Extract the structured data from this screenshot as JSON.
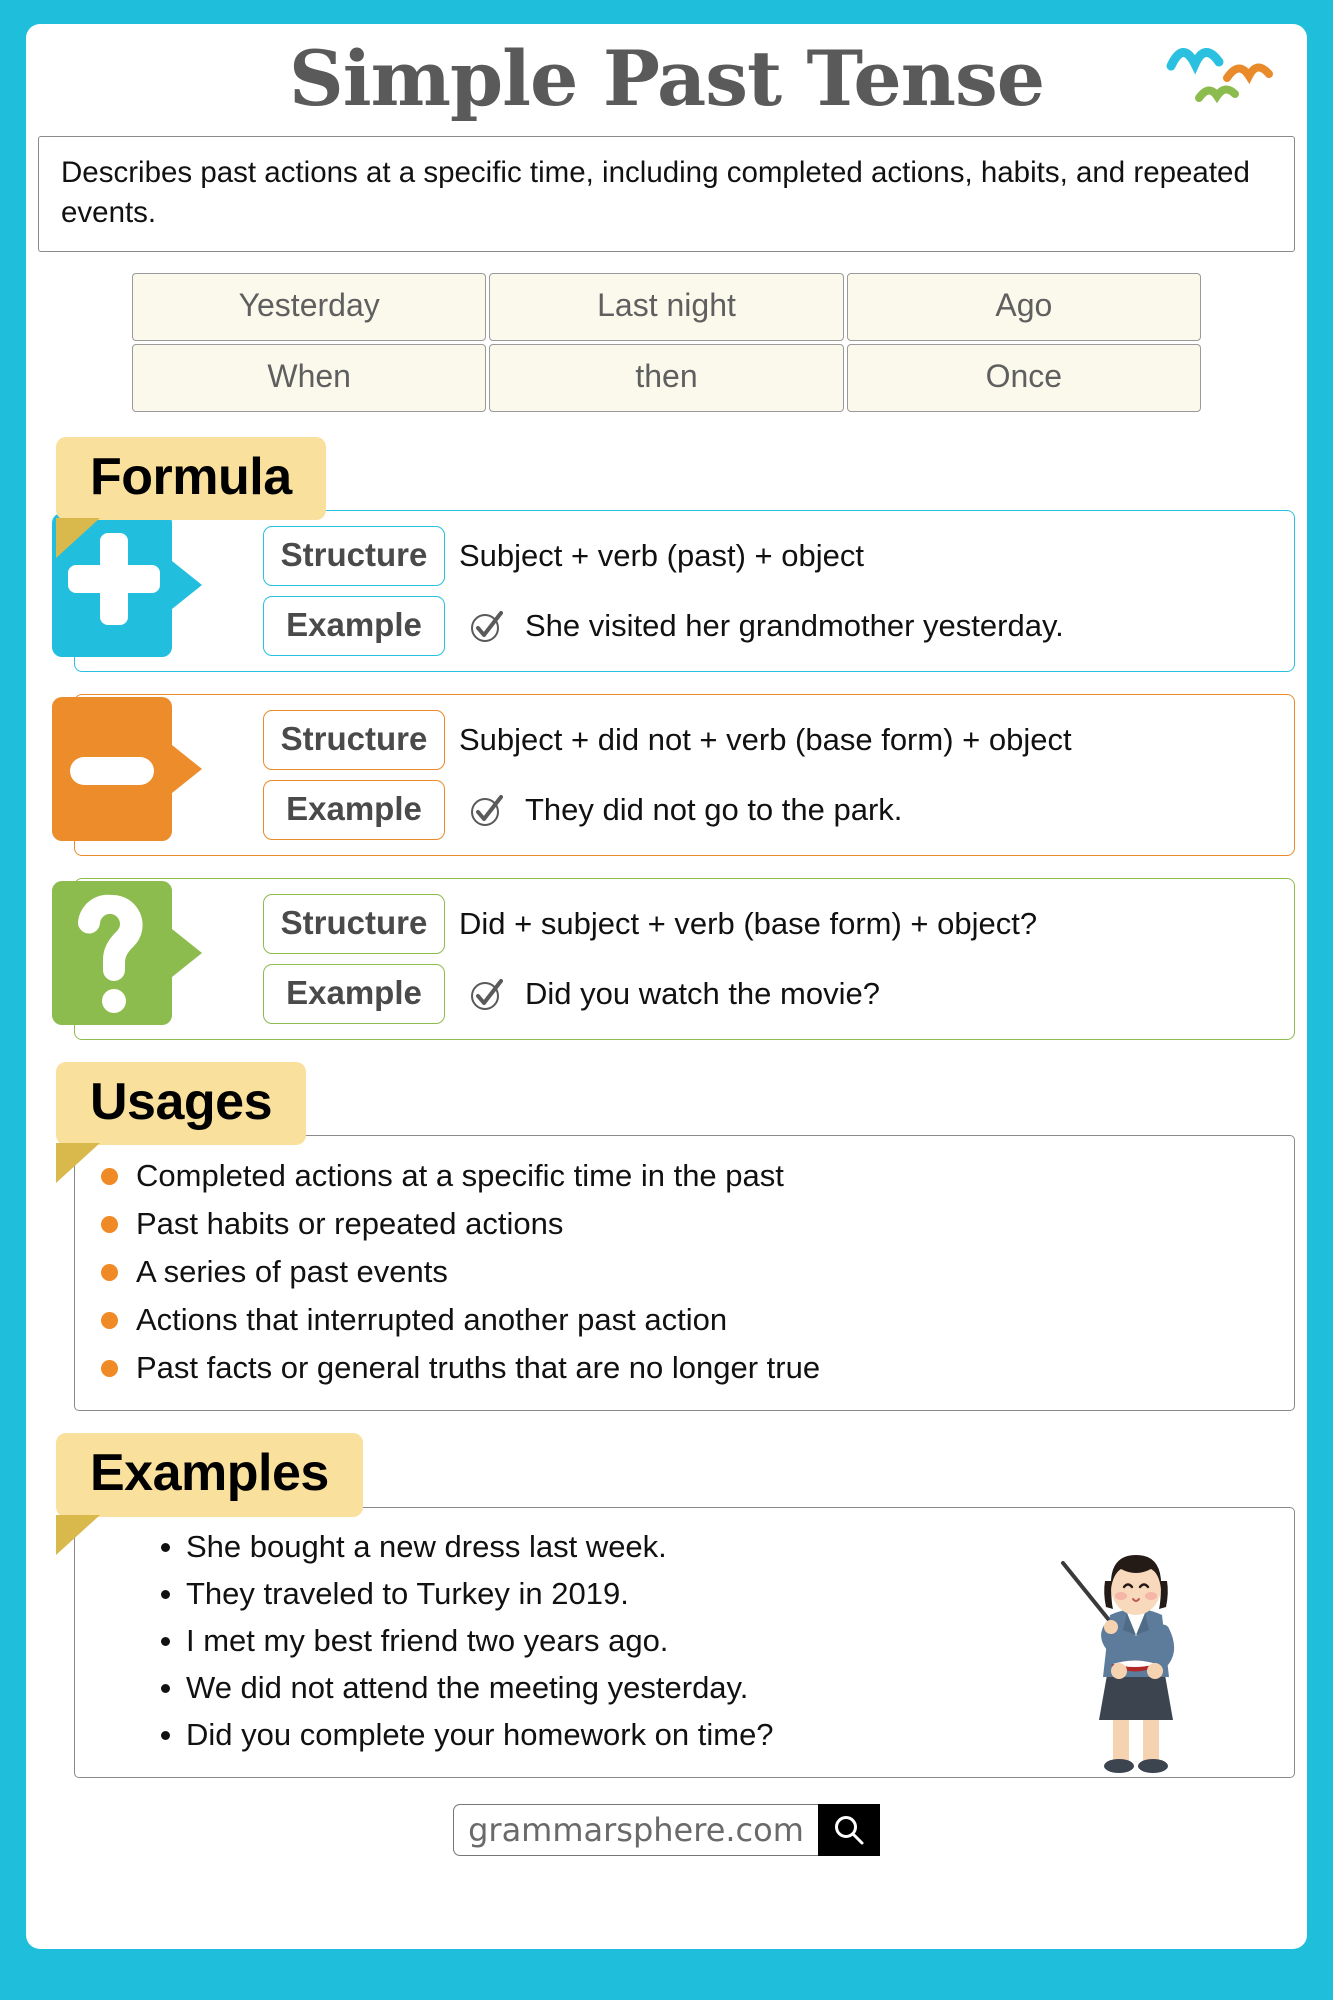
{
  "theme": {
    "background": "#1FBFDC",
    "card": "#ffffff",
    "tab_yellow": "#F9E09C",
    "tab_fold": "#D9B84C",
    "positive": "#2AC0E0",
    "negative": "#E98A2B",
    "question": "#8CBB4E",
    "bullet_orange": "#EF8A26",
    "keyword_cell": "#FBF9EC",
    "title_gray": "#5a5a5a"
  },
  "decorations": {
    "birds": [
      {
        "name": "bird-cyan",
        "color": "#2AC0E0"
      },
      {
        "name": "bird-orange",
        "color": "#E98A2B"
      },
      {
        "name": "bird-green",
        "color": "#8CBB4E"
      }
    ]
  },
  "header": {
    "title": "Simple Past Tense",
    "description": "Describes past actions at a specific time, including completed actions, habits, and repeated events."
  },
  "keywords": {
    "rows": [
      [
        "Yesterday",
        "Last night",
        "Ago"
      ],
      [
        "When",
        "then",
        "Once"
      ]
    ]
  },
  "formula": {
    "heading": "Formula",
    "structure_label": "Structure",
    "example_label": "Example",
    "rows": [
      {
        "type": "positive",
        "icon": "plus-icon",
        "structure": "Subject + verb (past) + object",
        "example": "She visited her grandmother yesterday."
      },
      {
        "type": "negative",
        "icon": "minus-icon",
        "structure": "Subject + did not + verb (base form) + object",
        "example": "They did not go to the park."
      },
      {
        "type": "question",
        "icon": "question-mark-icon",
        "structure": "Did + subject + verb (base form) + object?",
        "example": "Did you watch the movie?"
      }
    ]
  },
  "usages": {
    "heading": "Usages",
    "items": [
      "Completed actions at a specific time in the past",
      "Past habits or repeated actions",
      "A series of past events",
      "Actions that interrupted another past action",
      "Past facts or general truths that are no longer true"
    ]
  },
  "examples": {
    "heading": "Examples",
    "items": [
      "She bought a new dress last week.",
      "They traveled to Turkey in 2019.",
      "I met my best friend two years ago.",
      "We did not attend the meeting yesterday.",
      "Did you complete your homework on time?"
    ],
    "illustration": "teacher-with-pointer-illustration"
  },
  "footer": {
    "site": "grammarsphere.com",
    "search_icon": "magnifier-icon"
  }
}
